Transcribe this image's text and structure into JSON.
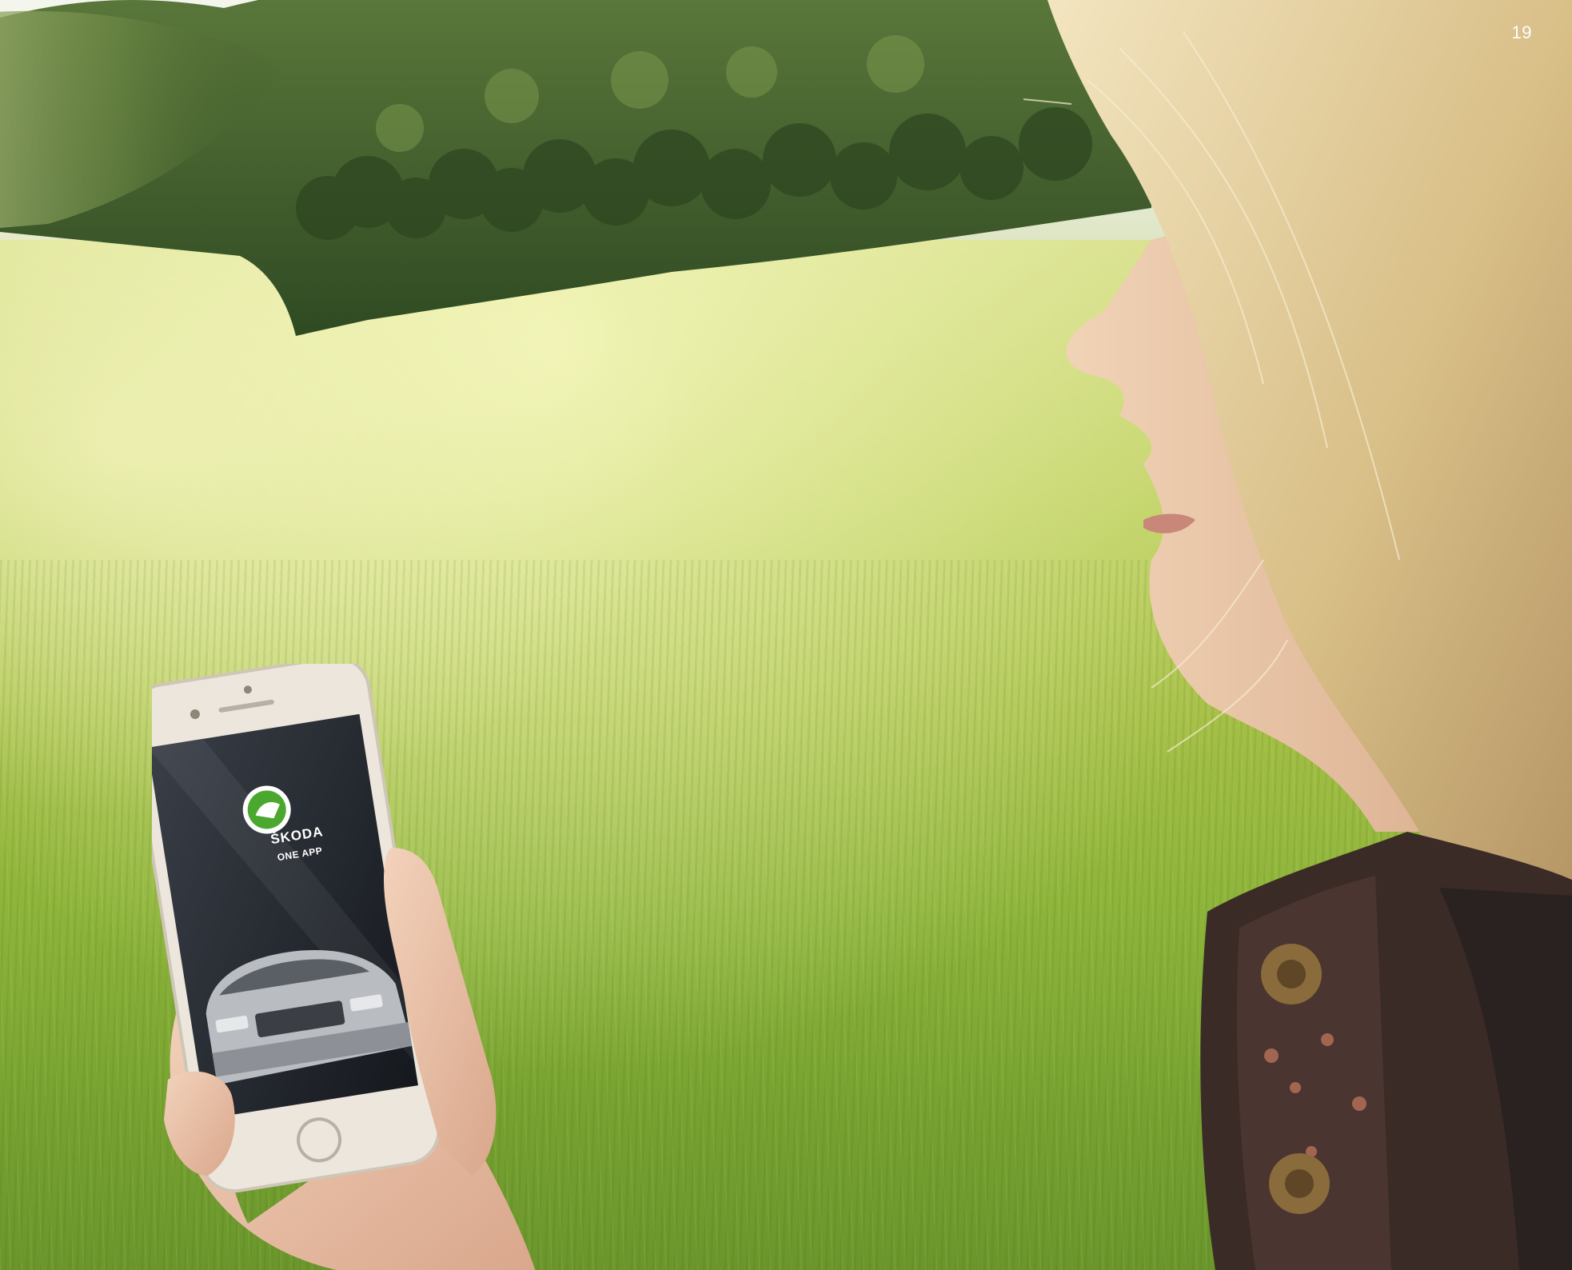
{
  "page": {
    "number": "19"
  },
  "phone_screen": {
    "brand": "ŠKODA",
    "app_name": "ONE APP"
  },
  "colors": {
    "meadow": "#a6c046",
    "forest": "#3f5a2a",
    "hair": "#e3cf9f",
    "skin": "#e7c3a3",
    "jacket": "#3a2b27",
    "phone_body": "#ece6dc",
    "phone_screen": "#2b3038",
    "skoda_green": "#4ba82e"
  }
}
